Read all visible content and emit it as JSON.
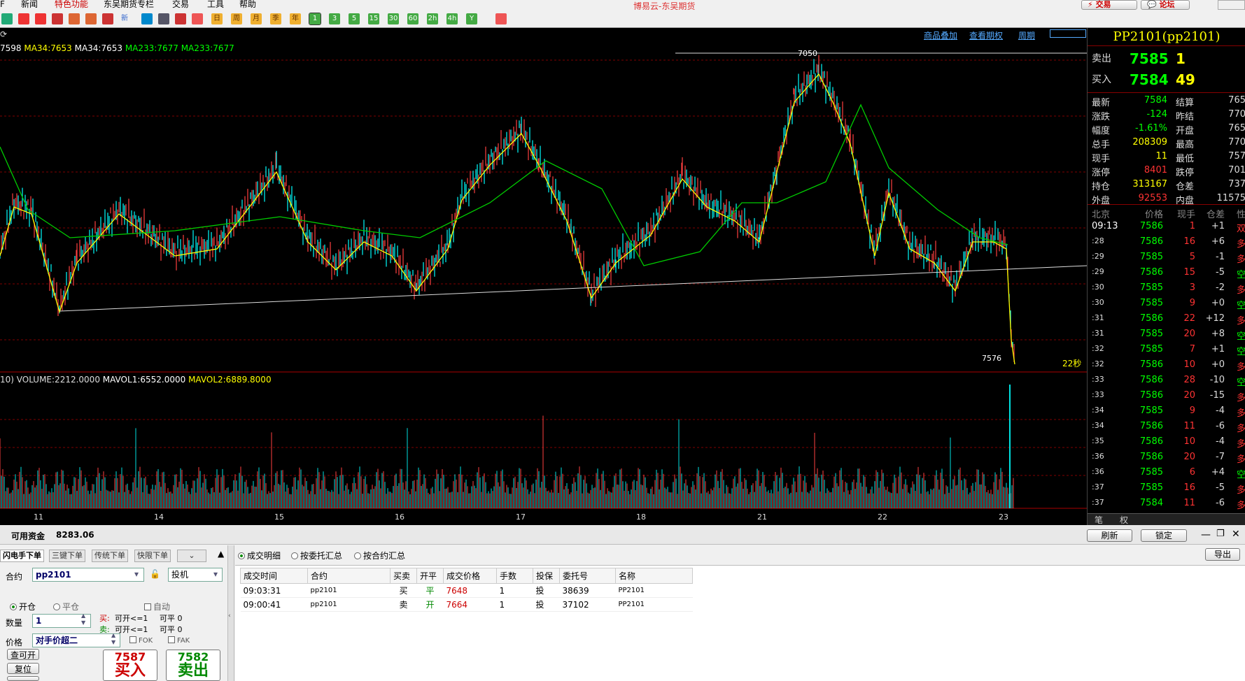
{
  "menu": [
    "F",
    "新闻",
    "特色功能",
    "东吴期货专栏",
    "交易",
    "工具",
    "帮助"
  ],
  "brand": "博易云-东吴期货",
  "top_buttons": {
    "trade": "交易",
    "forum": "论坛"
  },
  "toolbar": {
    "icons": [
      "refresh-icon",
      "zoom-in-icon",
      "zoom-out-icon",
      "window-icon",
      "pen-icon",
      "paint-icon",
      "alert-icon",
      "new-icon",
      "table-icon",
      "chart-icon",
      "tick-icon"
    ],
    "period_buttons": [
      "日",
      "周",
      "月",
      "季",
      "年",
      "1",
      "3",
      "5",
      "15",
      "30",
      "60",
      "2h",
      "4h",
      "Y"
    ],
    "new_label": "新"
  },
  "chart_header": {
    "links": [
      "商品叠加",
      "查看期权",
      "周期"
    ]
  },
  "ma_line": [
    {
      "text": "7598",
      "color": "#ffffff"
    },
    {
      "text": "MA34:7653",
      "color": "#ffff00"
    },
    {
      "text": "MA34:7653",
      "color": "#ffffff"
    },
    {
      "text": "MA233:7677",
      "color": "#00ff00"
    },
    {
      "text": "MA233:7677",
      "color": "#00ff00"
    }
  ],
  "volume_line": [
    {
      "text": "10) VOLUME:2212.0000",
      "color": "#dddddd"
    },
    {
      "text": "MAVOL1:6552.0000",
      "color": "#ffffff"
    },
    {
      "text": "MAVOL2:6889.8000",
      "color": "#ffff00"
    }
  ],
  "chart_labels": {
    "high": "7050",
    "low": "7576",
    "countdown": "22秒"
  },
  "x_axis": [
    "11",
    "14",
    "15",
    "16",
    "17",
    "18",
    "21",
    "22",
    "23"
  ],
  "quote": {
    "title": "PP2101(pp2101)",
    "sell_label": "卖出",
    "sell_price": "7585",
    "sell_vol": "1",
    "buy_label": "买入",
    "buy_price": "7584",
    "buy_vol": "49",
    "stats": [
      [
        "最新",
        "7584",
        "结算",
        "765"
      ],
      [
        "涨跌",
        "-124",
        "昨结",
        "770"
      ],
      [
        "幅度",
        "-1.61%",
        "开盘",
        "765"
      ],
      [
        "总手",
        "208309",
        "最高",
        "770"
      ],
      [
        "现手",
        "11",
        "最低",
        "757"
      ],
      [
        "涨停",
        "8401",
        "跌停",
        "701"
      ],
      [
        "持仓",
        "313167",
        "仓差",
        "737"
      ],
      [
        "外盘",
        "92553",
        "内盘",
        "11575"
      ]
    ],
    "tick_header": [
      "北京",
      "价格",
      "现手",
      "仓差",
      "性"
    ],
    "ticks": [
      [
        "09:13",
        "7586",
        "1",
        "+1",
        "双"
      ],
      [
        ":28",
        "7586",
        "16",
        "+6",
        "多"
      ],
      [
        ":29",
        "7585",
        "5",
        "-1",
        "多"
      ],
      [
        ":29",
        "7586",
        "15",
        "-5",
        "空"
      ],
      [
        ":30",
        "7585",
        "3",
        "-2",
        "多"
      ],
      [
        ":30",
        "7585",
        "9",
        "+0",
        "空"
      ],
      [
        ":31",
        "7586",
        "22",
        "+12",
        "多"
      ],
      [
        ":31",
        "7585",
        "20",
        "+8",
        "空"
      ],
      [
        ":32",
        "7585",
        "7",
        "+1",
        "空"
      ],
      [
        ":32",
        "7586",
        "10",
        "+0",
        "多"
      ],
      [
        ":33",
        "7586",
        "28",
        "-10",
        "空"
      ],
      [
        ":33",
        "7586",
        "20",
        "-15",
        "多"
      ],
      [
        ":34",
        "7585",
        "9",
        "-4",
        "多"
      ],
      [
        ":34",
        "7586",
        "11",
        "-6",
        "多"
      ],
      [
        ":35",
        "7586",
        "10",
        "-4",
        "多"
      ],
      [
        ":36",
        "7586",
        "20",
        "-7",
        "多"
      ],
      [
        ":36",
        "7585",
        "6",
        "+4",
        "空"
      ],
      [
        ":37",
        "7585",
        "16",
        "-5",
        "多"
      ],
      [
        ":37",
        "7584",
        "11",
        "-6",
        "多"
      ]
    ],
    "bottom_tabs": [
      "笔",
      "权"
    ]
  },
  "bottom": {
    "funds_label": "可用资金",
    "funds_value": "8283.06",
    "refresh": "刷新",
    "lock": "锁定",
    "export": "导出",
    "order_tabs": [
      "闪电手下单",
      "三键下单",
      "传统下单",
      "快限下单"
    ],
    "contract_label": "合约",
    "contract_value": "pp2101",
    "hedge_value": "投机",
    "open_label": "开仓",
    "close_label": "平仓",
    "auto_label": "自动",
    "qty_label": "数量",
    "qty_value": "1",
    "buy_text": "买:",
    "buy_open": "可开<=1",
    "buy_close": "可平 0",
    "sell_text": "卖:",
    "sell_open": "可开<=1",
    "sell_close": "可平 0",
    "price_label": "价格",
    "price_value": "对手价超二",
    "fok": "FOK",
    "fak": "FAK",
    "query_open": "查可开",
    "reset": "复位",
    "buy_price": "7587",
    "sell_price": "7582",
    "buy_action": "买入",
    "sell_action": "卖出",
    "view_tabs": [
      "成交明细",
      "按委托汇总",
      "按合约汇总"
    ],
    "table_headers": [
      "成交时间",
      "合约",
      "买卖",
      "开平",
      "成交价格",
      "手数",
      "投保",
      "委托号",
      "名称"
    ],
    "table_rows": [
      [
        "09:03:31",
        "pp2101",
        "买",
        "平",
        "7648",
        "1",
        "投",
        "38639",
        "PP2101"
      ],
      [
        "09:00:41",
        "pp2101",
        "卖",
        "开",
        "7664",
        "1",
        "投",
        "37102",
        "PP2101"
      ]
    ]
  },
  "colors": {
    "up": "#ff4040",
    "down": "#00ffff",
    "ma_yellow": "#ffff00",
    "ma_green": "#00cc00",
    "red_grid": "#800000"
  }
}
